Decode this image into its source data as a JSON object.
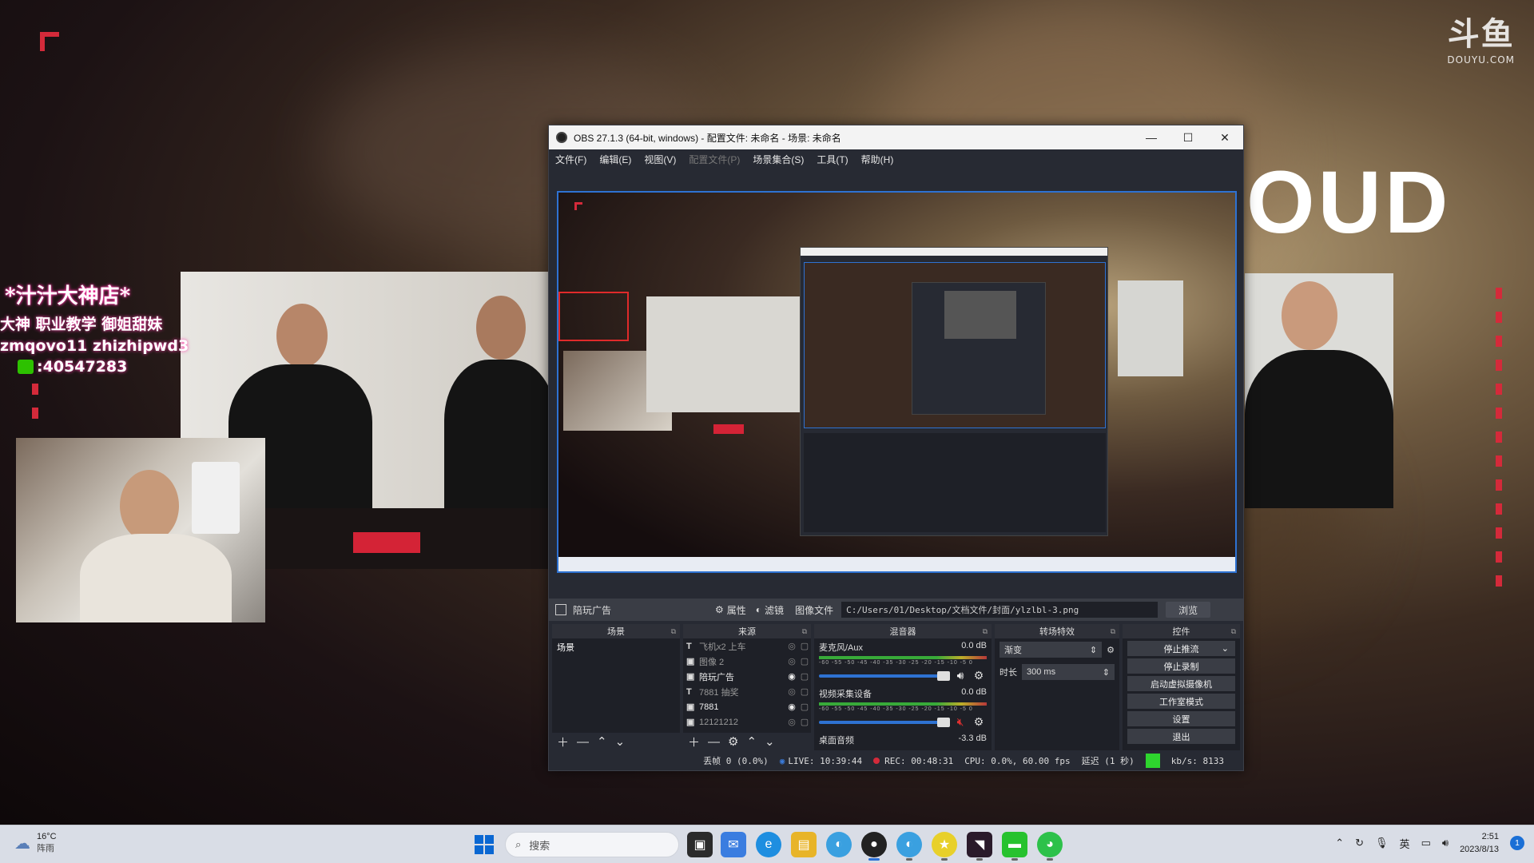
{
  "desktop": {
    "overlay": {
      "store_name": "*汁汁大神店*",
      "line1": "大神 职业教学 御姐甜妹",
      "line2": "zmqovo11  zhizhipwd3",
      "wechat_id": ":40547283",
      "brand_big": "斗鱼",
      "brand_small": "DOUYU.COM",
      "big_text": "OUD"
    }
  },
  "obs": {
    "title": "OBS 27.1.3 (64-bit, windows) - 配置文件: 未命名 - 场景: 未命名",
    "window_controls": {
      "minimize": "—",
      "maximize": "☐",
      "close": "✕"
    },
    "menu": [
      {
        "label": "文件(F)",
        "enabled": true
      },
      {
        "label": "编辑(E)",
        "enabled": true
      },
      {
        "label": "视图(V)",
        "enabled": true
      },
      {
        "label": "配置文件(P)",
        "enabled": false
      },
      {
        "label": "场景集合(S)",
        "enabled": true
      },
      {
        "label": "工具(T)",
        "enabled": true
      },
      {
        "label": "帮助(H)",
        "enabled": true
      }
    ],
    "source_bar": {
      "selected_source": "陪玩广告",
      "properties": "属性",
      "filters": "滤镜",
      "image_file_label": "图像文件",
      "path": "C:/Users/01/Desktop/文档文件/封面/ylzlbl-3.png",
      "browse": "浏览"
    },
    "docks": {
      "scenes": {
        "title": "场景",
        "items": [
          "场景"
        ]
      },
      "sources": {
        "title": "来源",
        "items": [
          {
            "icon": "T",
            "name": "飞机x2 上车",
            "visible": false
          },
          {
            "icon": "▣",
            "name": "图像 2",
            "visible": false
          },
          {
            "icon": "▣",
            "name": "陪玩广告",
            "visible": true
          },
          {
            "icon": "T",
            "name": "7881 抽奖",
            "visible": false
          },
          {
            "icon": "▣",
            "name": "7881",
            "visible": true
          },
          {
            "icon": "▣",
            "name": "12121212",
            "visible": false
          }
        ]
      },
      "mixer": {
        "title": "混音器",
        "scale": "-60 -55 -50 -45 -40 -35 -30 -25 -20 -15 -10 -5 0",
        "channels": [
          {
            "name": "麦克风/Aux",
            "db": "0.0 dB",
            "muted": false
          },
          {
            "name": "视频采集设备",
            "db": "0.0 dB",
            "muted": true
          },
          {
            "name": "桌面音频",
            "db": "-3.3 dB",
            "muted": false
          }
        ]
      },
      "transitions": {
        "title": "转场特效",
        "type": "渐变",
        "duration_label": "时长",
        "duration": "300 ms"
      },
      "controls": {
        "title": "控件",
        "buttons": [
          "停止推流",
          "停止录制",
          "启动虚拟摄像机",
          "工作室模式",
          "设置",
          "退出"
        ]
      }
    },
    "status": {
      "dropped": "丢帧 0 (0.0%)",
      "live": "LIVE: 10:39:44",
      "rec": "REC: 00:48:31",
      "cpu": "CPU: 0.0%, 60.00 fps",
      "delay": "延迟 (1 秒)",
      "bitrate": "kb/s: 8133"
    }
  },
  "taskbar": {
    "weather_temp": "16°C",
    "weather_desc": "阵雨",
    "search_placeholder": "搜索",
    "tray_lang": "英",
    "time": "2:51",
    "date": "2023/8/13",
    "notification_count": "1"
  },
  "colors": {
    "accent_blue": "#2e72d2",
    "brand_red": "#d42336",
    "obs_bg": "#272a33"
  }
}
